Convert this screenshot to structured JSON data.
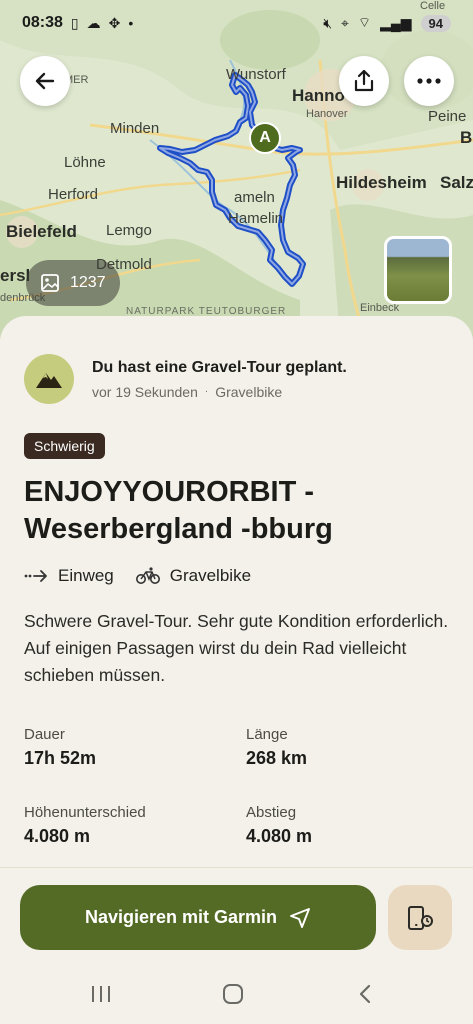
{
  "status_bar": {
    "time": "08:38",
    "battery": "94"
  },
  "map": {
    "labels": {
      "wunstorf": "Wunstorf",
      "hannover_big": "Hanno",
      "hannover_small": "Hanover",
      "peine": "Peine",
      "minden": "Minden",
      "loehne": "Löhne",
      "herford": "Herford",
      "hildesheim": "Hildesheim",
      "salz": "Salz",
      "hameln": "ameln",
      "hamelin": "Hamelin",
      "bielefeld": "Bielefeld",
      "lemgo": "Lemgo",
      "detmold": "Detmold",
      "ersl": "ersl",
      "denbruck": "denbrück",
      "naturpark": "NATURPARK TEUTOBURGER",
      "einbeck": "Einbeck",
      "b": "B",
      "mer": "MER",
      "celle": "Celle"
    },
    "start_marker": "A",
    "photo_count": "1237"
  },
  "notice": {
    "title": "Du hast eine Gravel-Tour geplant.",
    "time": "vor 19 Sekunden",
    "separator": "·",
    "sport": "Gravelbike"
  },
  "tour": {
    "difficulty": "Schwierig",
    "title": "ENJOYYOURORBIT - Weserbergland -bburg",
    "direction": "Einweg",
    "sport": "Gravelbike",
    "description": "Schwere Gravel-Tour. Sehr gute Kondition erforderlich. Auf einigen Passagen wirst du dein Rad vielleicht schieben müssen."
  },
  "stats": {
    "duration_label": "Dauer",
    "duration_value": "17h 52m",
    "length_label": "Länge",
    "length_value": "268 km",
    "elevation_label": "Höhenunterschied",
    "elevation_value": "4.080 m",
    "descent_label": "Abstieg",
    "descent_value": "4.080 m"
  },
  "actions": {
    "navigate_label": "Navigieren mit Garmin"
  },
  "colors": {
    "route": "#1f4fc7",
    "primary": "#546b26",
    "badge": "#3b2a22",
    "sheet": "#f4f1ea"
  }
}
